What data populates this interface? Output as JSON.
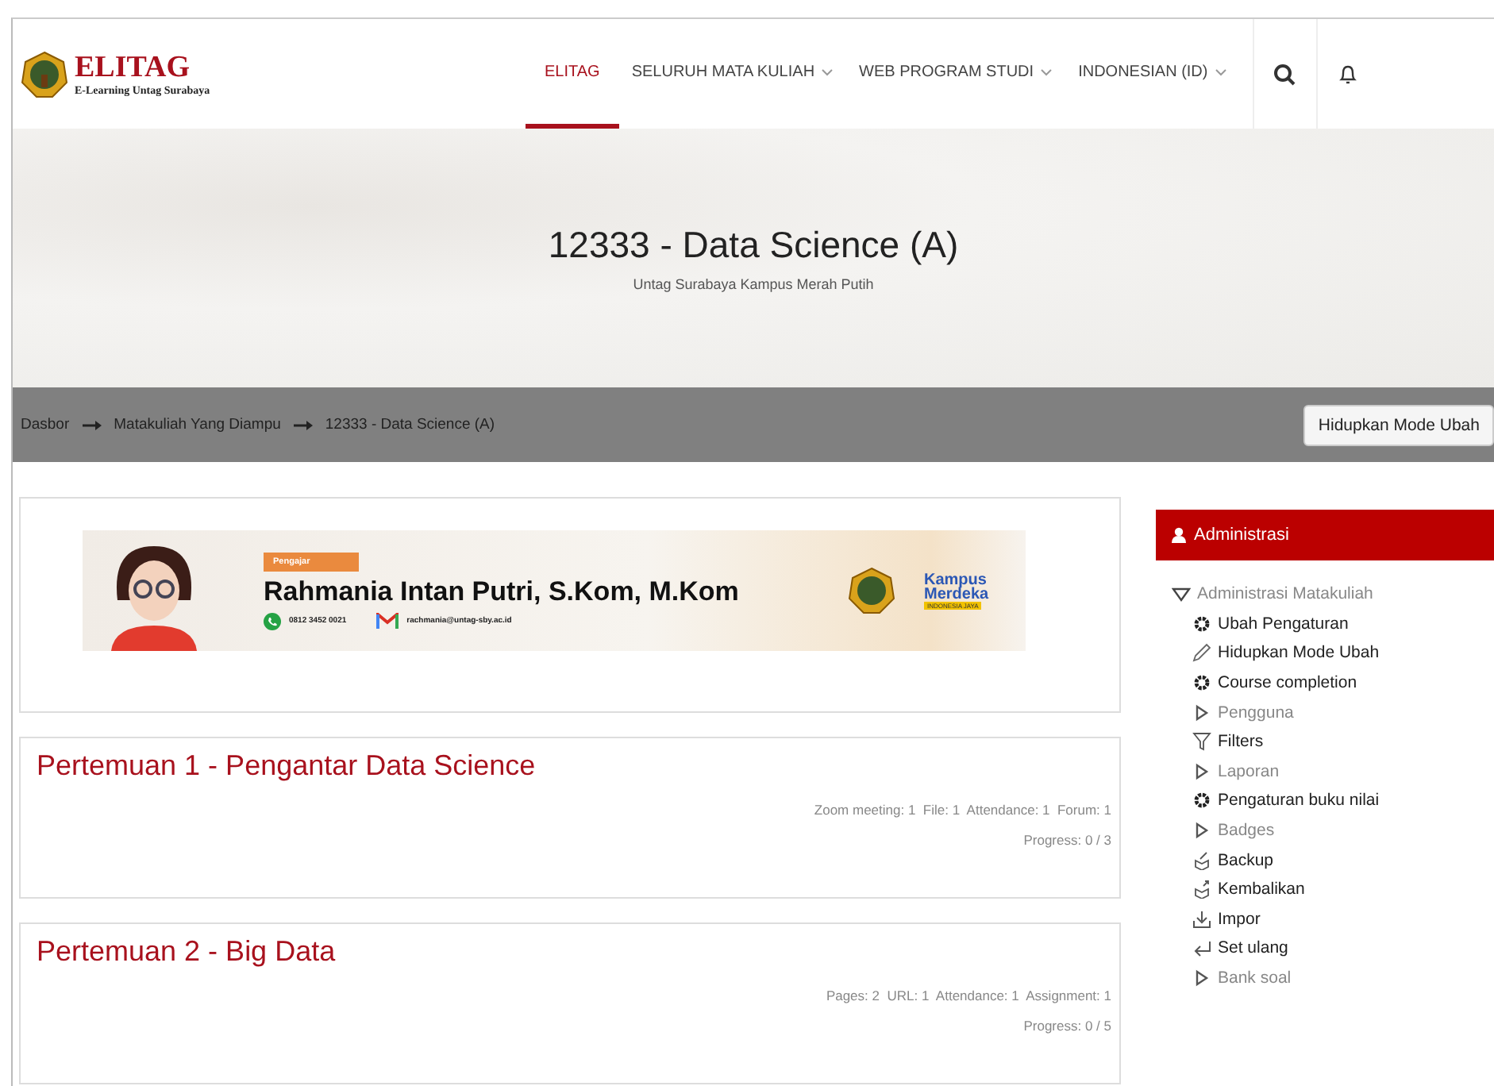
{
  "header": {
    "logo": {
      "title": "ELITAG",
      "subtitle": "E-Learning Untag Surabaya"
    },
    "nav": [
      {
        "label": "ELITAG",
        "selected": true,
        "has_menu": false
      },
      {
        "label": "SELURUH MATA KULIAH",
        "selected": false,
        "has_menu": true
      },
      {
        "label": "WEB PROGRAM STUDI",
        "selected": false,
        "has_menu": true
      },
      {
        "label": "INDONESIAN (ID)",
        "selected": false,
        "has_menu": true
      }
    ]
  },
  "hero": {
    "title": "12333 - Data Science (A)",
    "subtitle": "Untag Surabaya Kampus Merah Putih"
  },
  "breadcrumb": {
    "items": [
      "Dasbor",
      "Matakuliah Yang Diampu",
      "12333 - Data Science (A)"
    ],
    "button": "Hidupkan Mode Ubah"
  },
  "banner": {
    "role": "Pengajar",
    "name": "Rahmania Intan Putri, S.Kom, M.Kom",
    "phone": "0812 3452 0021",
    "email": "rachmania@untag-sby.ac.id",
    "brand": [
      "Kampus",
      "Merdeka",
      "INDONESIA JAYA"
    ]
  },
  "sections": [
    {
      "title": "Pertemuan 1 - Pengantar Data Science",
      "activities": "Zoom meeting: 1  File: 1  Attendance: 1  Forum: 1",
      "progress": "Progress: 0 / 3"
    },
    {
      "title": "Pertemuan 2 - Big Data",
      "activities": "Pages: 2  URL: 1  Attendance: 1  Assignment: 1",
      "progress": "Progress: 0 / 5"
    }
  ],
  "admin": {
    "title": "Administrasi",
    "tree": [
      {
        "label": "Administrasi Matakuliah",
        "expanded": true,
        "children": [
          {
            "label": "Ubah Pengaturan",
            "kind": "gear"
          },
          {
            "label": "Hidupkan Mode Ubah",
            "kind": "pencil"
          },
          {
            "label": "Course completion",
            "kind": "gear"
          },
          {
            "label": "Pengguna",
            "kind": "branch"
          },
          {
            "label": "Filters",
            "kind": "filter"
          },
          {
            "label": "Laporan",
            "kind": "branch"
          },
          {
            "label": "Pengaturan buku nilai",
            "kind": "gear"
          },
          {
            "label": "Badges",
            "kind": "branch"
          },
          {
            "label": "Backup",
            "kind": "backup"
          },
          {
            "label": "Kembalikan",
            "kind": "restore"
          },
          {
            "label": "Impor",
            "kind": "import"
          },
          {
            "label": "Set ulang",
            "kind": "reset"
          },
          {
            "label": "Bank soal",
            "kind": "branch"
          }
        ]
      }
    ]
  }
}
